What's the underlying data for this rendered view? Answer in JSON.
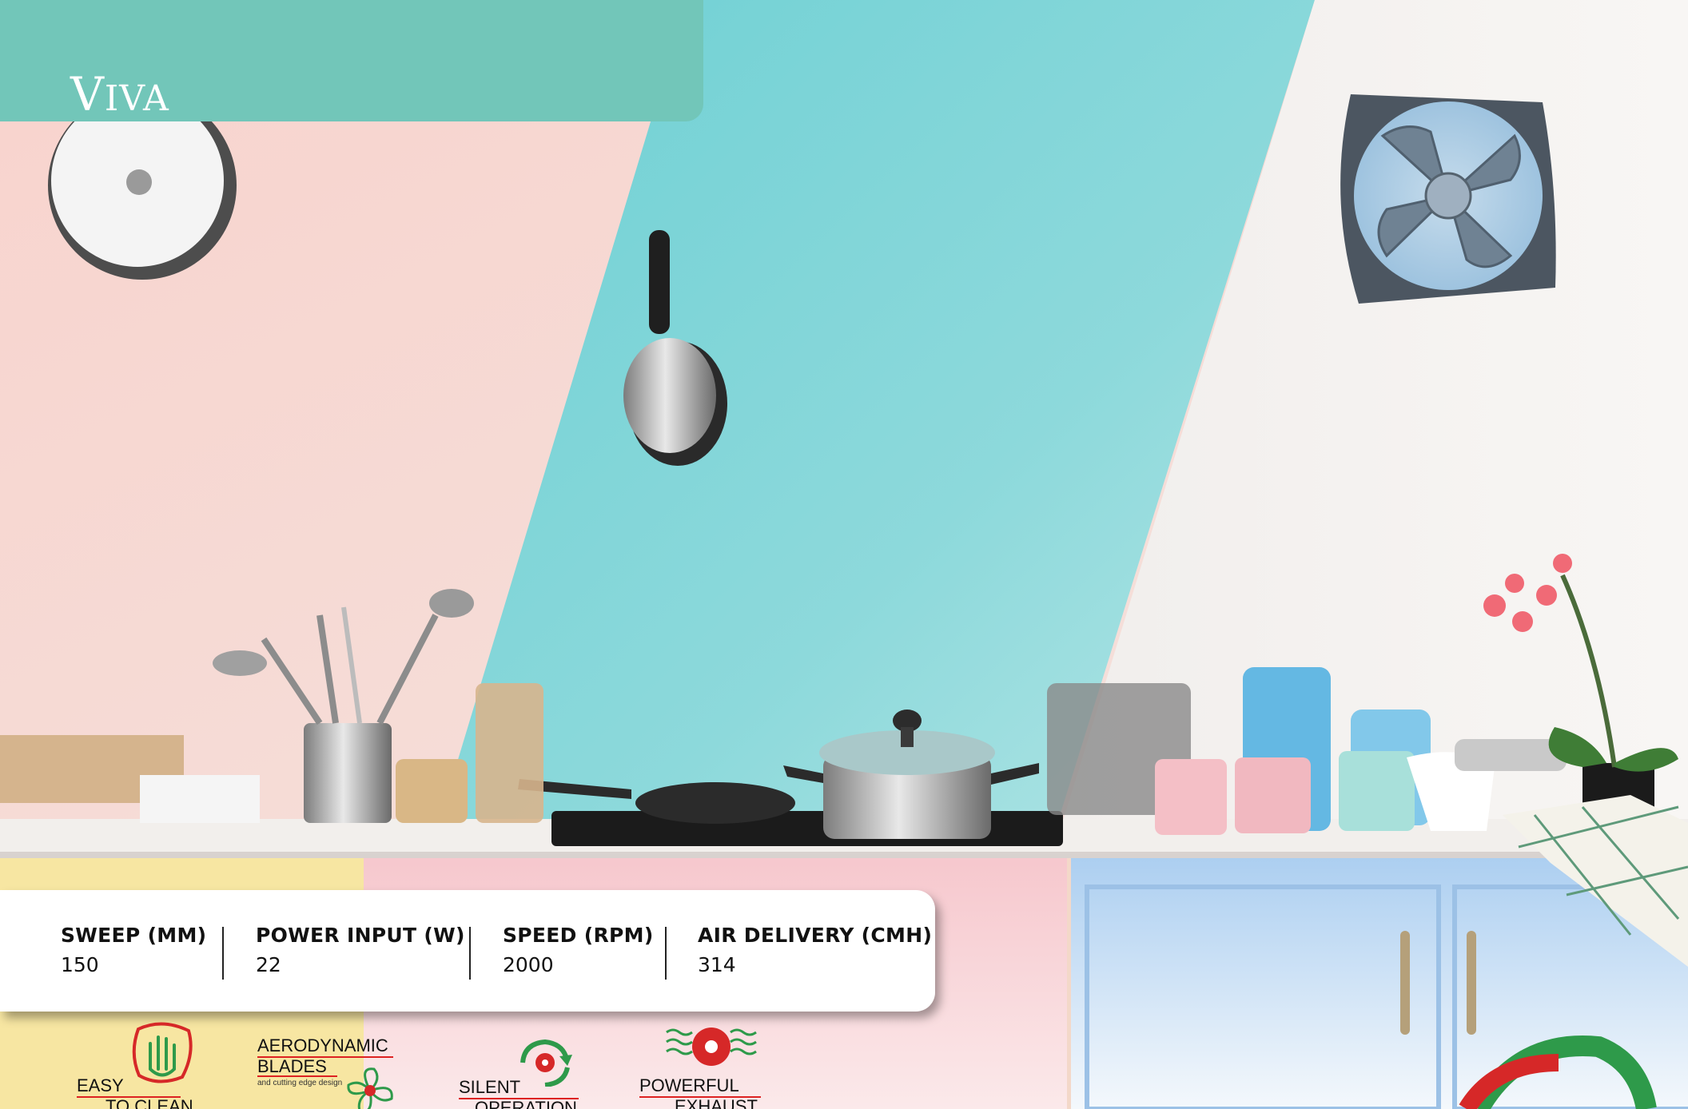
{
  "brand": {
    "title_first": "V",
    "title_rest": "IVA"
  },
  "specs": [
    {
      "label": "SWEEP (MM)",
      "value": "150"
    },
    {
      "label": "POWER INPUT (W)",
      "value": "22"
    },
    {
      "label": "SPEED (RPM)",
      "value": "2000"
    },
    {
      "label": "AIR DELIVERY (CMH)",
      "value": "314"
    }
  ],
  "features": {
    "easy_clean": {
      "line1": "EASY",
      "line2": "TO CLEAN"
    },
    "aero": {
      "line1": "AERODYNAMIC",
      "line2": "BLADES",
      "note": "and cutting edge design"
    },
    "silent": {
      "line1": "SILENT",
      "line2": "OPERATION"
    },
    "powerful": {
      "line1": "POWERFUL",
      "line2": "EXHAUST"
    }
  },
  "colors": {
    "teal_band": "#72c6b9",
    "wall_blue": "#7fd3d8",
    "wall_pink": "#f6d6d3",
    "accent_red": "#d62828",
    "accent_green": "#2e9a4a"
  }
}
